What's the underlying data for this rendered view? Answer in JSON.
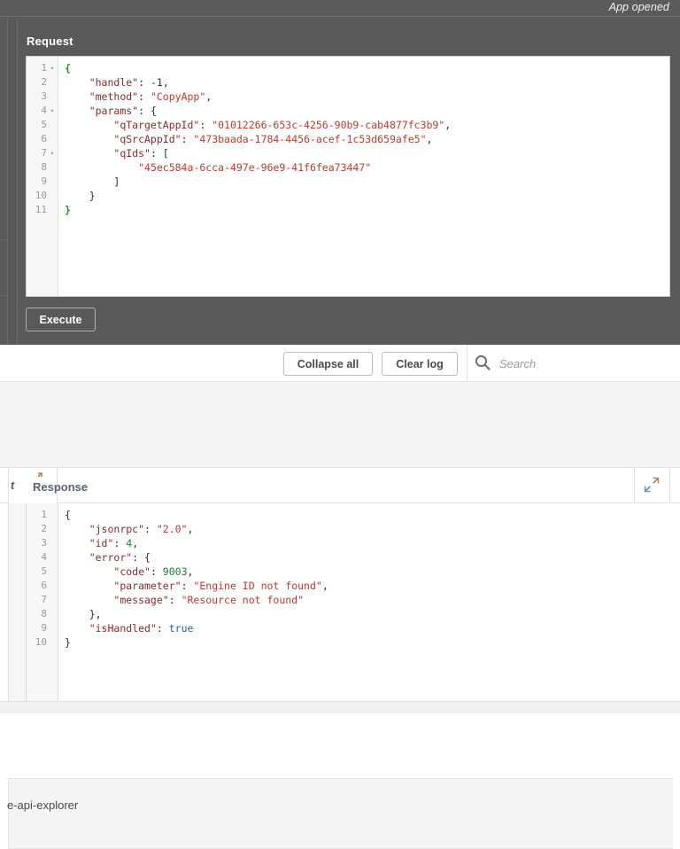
{
  "status": {
    "message": "App opened"
  },
  "request_panel": {
    "title": "Request",
    "execute_label": "Execute",
    "code_lines": [
      {
        "n": "1",
        "fold": "▾",
        "tokens": [
          {
            "t": "{",
            "c": "mb"
          }
        ]
      },
      {
        "n": "2",
        "fold": "",
        "tokens": [
          {
            "t": "    ",
            "c": "p"
          },
          {
            "t": "\"handle\"",
            "c": "k"
          },
          {
            "t": ": ",
            "c": "p"
          },
          {
            "t": "-1",
            "c": "p"
          },
          {
            "t": ",",
            "c": "p"
          }
        ]
      },
      {
        "n": "3",
        "fold": "",
        "tokens": [
          {
            "t": "    ",
            "c": "p"
          },
          {
            "t": "\"method\"",
            "c": "k"
          },
          {
            "t": ": ",
            "c": "p"
          },
          {
            "t": "\"CopyApp\"",
            "c": "s"
          },
          {
            "t": ",",
            "c": "p"
          }
        ]
      },
      {
        "n": "4",
        "fold": "▾",
        "tokens": [
          {
            "t": "    ",
            "c": "p"
          },
          {
            "t": "\"params\"",
            "c": "k"
          },
          {
            "t": ": ",
            "c": "p"
          },
          {
            "t": "{",
            "c": "p"
          }
        ]
      },
      {
        "n": "5",
        "fold": "",
        "tokens": [
          {
            "t": "        ",
            "c": "p"
          },
          {
            "t": "\"qTargetAppId\"",
            "c": "k"
          },
          {
            "t": ": ",
            "c": "p"
          },
          {
            "t": "\"01012266-653c-4256-90b9-cab4877fc3b9\"",
            "c": "s"
          },
          {
            "t": ",",
            "c": "p"
          }
        ]
      },
      {
        "n": "6",
        "fold": "",
        "tokens": [
          {
            "t": "        ",
            "c": "p"
          },
          {
            "t": "\"qSrcAppId\"",
            "c": "k"
          },
          {
            "t": ": ",
            "c": "p"
          },
          {
            "t": "\"473baada-1784-4456-acef-1c53d659afe5\"",
            "c": "s"
          },
          {
            "t": ",",
            "c": "p"
          }
        ]
      },
      {
        "n": "7",
        "fold": "▾",
        "tokens": [
          {
            "t": "        ",
            "c": "p"
          },
          {
            "t": "\"qIds\"",
            "c": "k"
          },
          {
            "t": ": ",
            "c": "p"
          },
          {
            "t": "[",
            "c": "p"
          }
        ]
      },
      {
        "n": "8",
        "fold": "",
        "tokens": [
          {
            "t": "            ",
            "c": "p"
          },
          {
            "t": "\"45ec584a-6cca-497e-96e9-41f6fea73447\"",
            "c": "s"
          }
        ]
      },
      {
        "n": "9",
        "fold": "",
        "tokens": [
          {
            "t": "        ",
            "c": "p"
          },
          {
            "t": "]",
            "c": "p"
          }
        ]
      },
      {
        "n": "10",
        "fold": "",
        "tokens": [
          {
            "t": "    ",
            "c": "p"
          },
          {
            "t": "}",
            "c": "p"
          }
        ]
      },
      {
        "n": "11",
        "fold": "",
        "tokens": [
          {
            "t": "}",
            "c": "mb"
          }
        ]
      }
    ]
  },
  "log_toolbar": {
    "collapse_all_label": "Collapse all",
    "clear_log_label": "Clear log",
    "search_placeholder": "Search",
    "search_value": "",
    "search_icon": "search-icon"
  },
  "breadcrumb": {
    "text": "e-api-explorer"
  },
  "response_panel": {
    "title": "Response",
    "left_label": "t",
    "expand_icon": "expand-arrows-icon",
    "code_lines": [
      {
        "n": "1",
        "tokens": [
          {
            "t": "{",
            "c": "p"
          }
        ]
      },
      {
        "n": "2",
        "tokens": [
          {
            "t": "    ",
            "c": "p"
          },
          {
            "t": "\"jsonrpc\"",
            "c": "k"
          },
          {
            "t": ": ",
            "c": "p"
          },
          {
            "t": "\"2.0\"",
            "c": "s"
          },
          {
            "t": ",",
            "c": "p"
          }
        ]
      },
      {
        "n": "3",
        "tokens": [
          {
            "t": "    ",
            "c": "p"
          },
          {
            "t": "\"id\"",
            "c": "k"
          },
          {
            "t": ": ",
            "c": "p"
          },
          {
            "t": "4",
            "c": "n"
          },
          {
            "t": ",",
            "c": "p"
          }
        ]
      },
      {
        "n": "4",
        "tokens": [
          {
            "t": "    ",
            "c": "p"
          },
          {
            "t": "\"error\"",
            "c": "k"
          },
          {
            "t": ": ",
            "c": "p"
          },
          {
            "t": "{",
            "c": "p"
          }
        ]
      },
      {
        "n": "5",
        "tokens": [
          {
            "t": "        ",
            "c": "p"
          },
          {
            "t": "\"code\"",
            "c": "k"
          },
          {
            "t": ": ",
            "c": "p"
          },
          {
            "t": "9003",
            "c": "n"
          },
          {
            "t": ",",
            "c": "p"
          }
        ]
      },
      {
        "n": "6",
        "tokens": [
          {
            "t": "        ",
            "c": "p"
          },
          {
            "t": "\"parameter\"",
            "c": "k"
          },
          {
            "t": ": ",
            "c": "p"
          },
          {
            "t": "\"Engine ID not found\"",
            "c": "s"
          },
          {
            "t": ",",
            "c": "p"
          }
        ]
      },
      {
        "n": "7",
        "tokens": [
          {
            "t": "        ",
            "c": "p"
          },
          {
            "t": "\"message\"",
            "c": "k"
          },
          {
            "t": ": ",
            "c": "p"
          },
          {
            "t": "\"Resource not found\"",
            "c": "s"
          }
        ]
      },
      {
        "n": "8",
        "tokens": [
          {
            "t": "    ",
            "c": "p"
          },
          {
            "t": "}",
            "c": "p"
          },
          {
            "t": ",",
            "c": "p"
          }
        ]
      },
      {
        "n": "9",
        "tokens": [
          {
            "t": "    ",
            "c": "p"
          },
          {
            "t": "\"isHandled\"",
            "c": "k"
          },
          {
            "t": ": ",
            "c": "p"
          },
          {
            "t": "true",
            "c": "b"
          }
        ]
      },
      {
        "n": "10",
        "tokens": [
          {
            "t": "}",
            "c": "p"
          }
        ]
      }
    ]
  },
  "colors": {
    "dark_pane": "#595959",
    "key": "#8b2a2a",
    "string": "#c0392b",
    "number": "#1a7f37",
    "boolean": "#2a5db0",
    "matched_bracket": "#16a016"
  }
}
